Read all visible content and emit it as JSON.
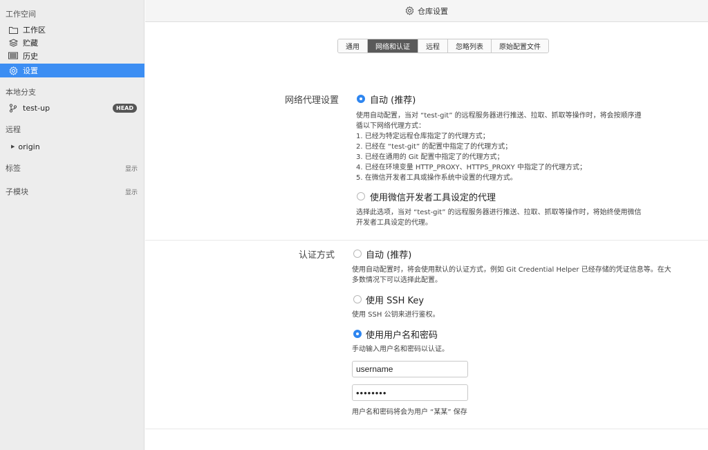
{
  "sidebar": {
    "workspace_title": "工作空间",
    "items": [
      {
        "label": "工作区",
        "icon": "folder-icon"
      },
      {
        "label": "贮藏",
        "icon": "stack-icon"
      },
      {
        "label": "历史",
        "icon": "history-icon"
      },
      {
        "label": "设置",
        "icon": "gear-icon",
        "active": true
      }
    ],
    "local_branch_title": "本地分支",
    "branch": {
      "name": "test-up",
      "badge": "HEAD"
    },
    "remote_title": "远程",
    "remote_item": "origin",
    "tags_title": "标签",
    "tags_action": "显示",
    "submodules_title": "子模块",
    "submodules_action": "显示"
  },
  "titlebar": {
    "title": "仓库设置"
  },
  "tabs": [
    "通用",
    "网络和认证",
    "远程",
    "忽略列表",
    "原始配置文件"
  ],
  "active_tab": "网络和认证",
  "proxy": {
    "label": "网络代理设置",
    "auto_option": "自动 (推荐)",
    "auto_desc": [
      "使用自动配置，当对 “test-git” 的远程服务器进行推送、拉取、抓取等操作时，将会按顺序遵",
      "循以下网络代理方式：",
      "1. 已经为特定远程仓库指定了的代理方式；",
      "2. 已经在 “test-git” 的配置中指定了的代理方式；",
      "3. 已经在通用的 Git 配置中指定了的代理方式；",
      "4. 已经在环境变量 HTTP_PROXY、HTTPS_PROXY 中指定了的代理方式；",
      "5. 在微信开发者工具或操作系统中设置的代理方式。"
    ],
    "wechat_option": "使用微信开发者工具设定的代理",
    "wechat_desc": [
      "选择此选项，当对 “test-git” 的远程服务器进行推送、拉取、抓取等操作时，将始终使用微信",
      "开发者工具设定的代理。"
    ]
  },
  "auth": {
    "label": "认证方式",
    "auto_option": "自动 (推荐)",
    "auto_desc": [
      "使用自动配置时，将会使用默认的认证方式，例如 Git Credential Helper 已经存储的凭证信息等。在大",
      "多数情况下可以选择此配置。"
    ],
    "ssh_option": "使用 SSH Key",
    "ssh_desc": "使用 SSH 公钥来进行鉴权。",
    "userpass_option": "使用用户名和密码",
    "userpass_desc": "手动输入用户名和密码以认证。",
    "username_value": "username",
    "password_value": "••••••••",
    "save_note": "用户名和密码将会为用户 “某某” 保存"
  }
}
